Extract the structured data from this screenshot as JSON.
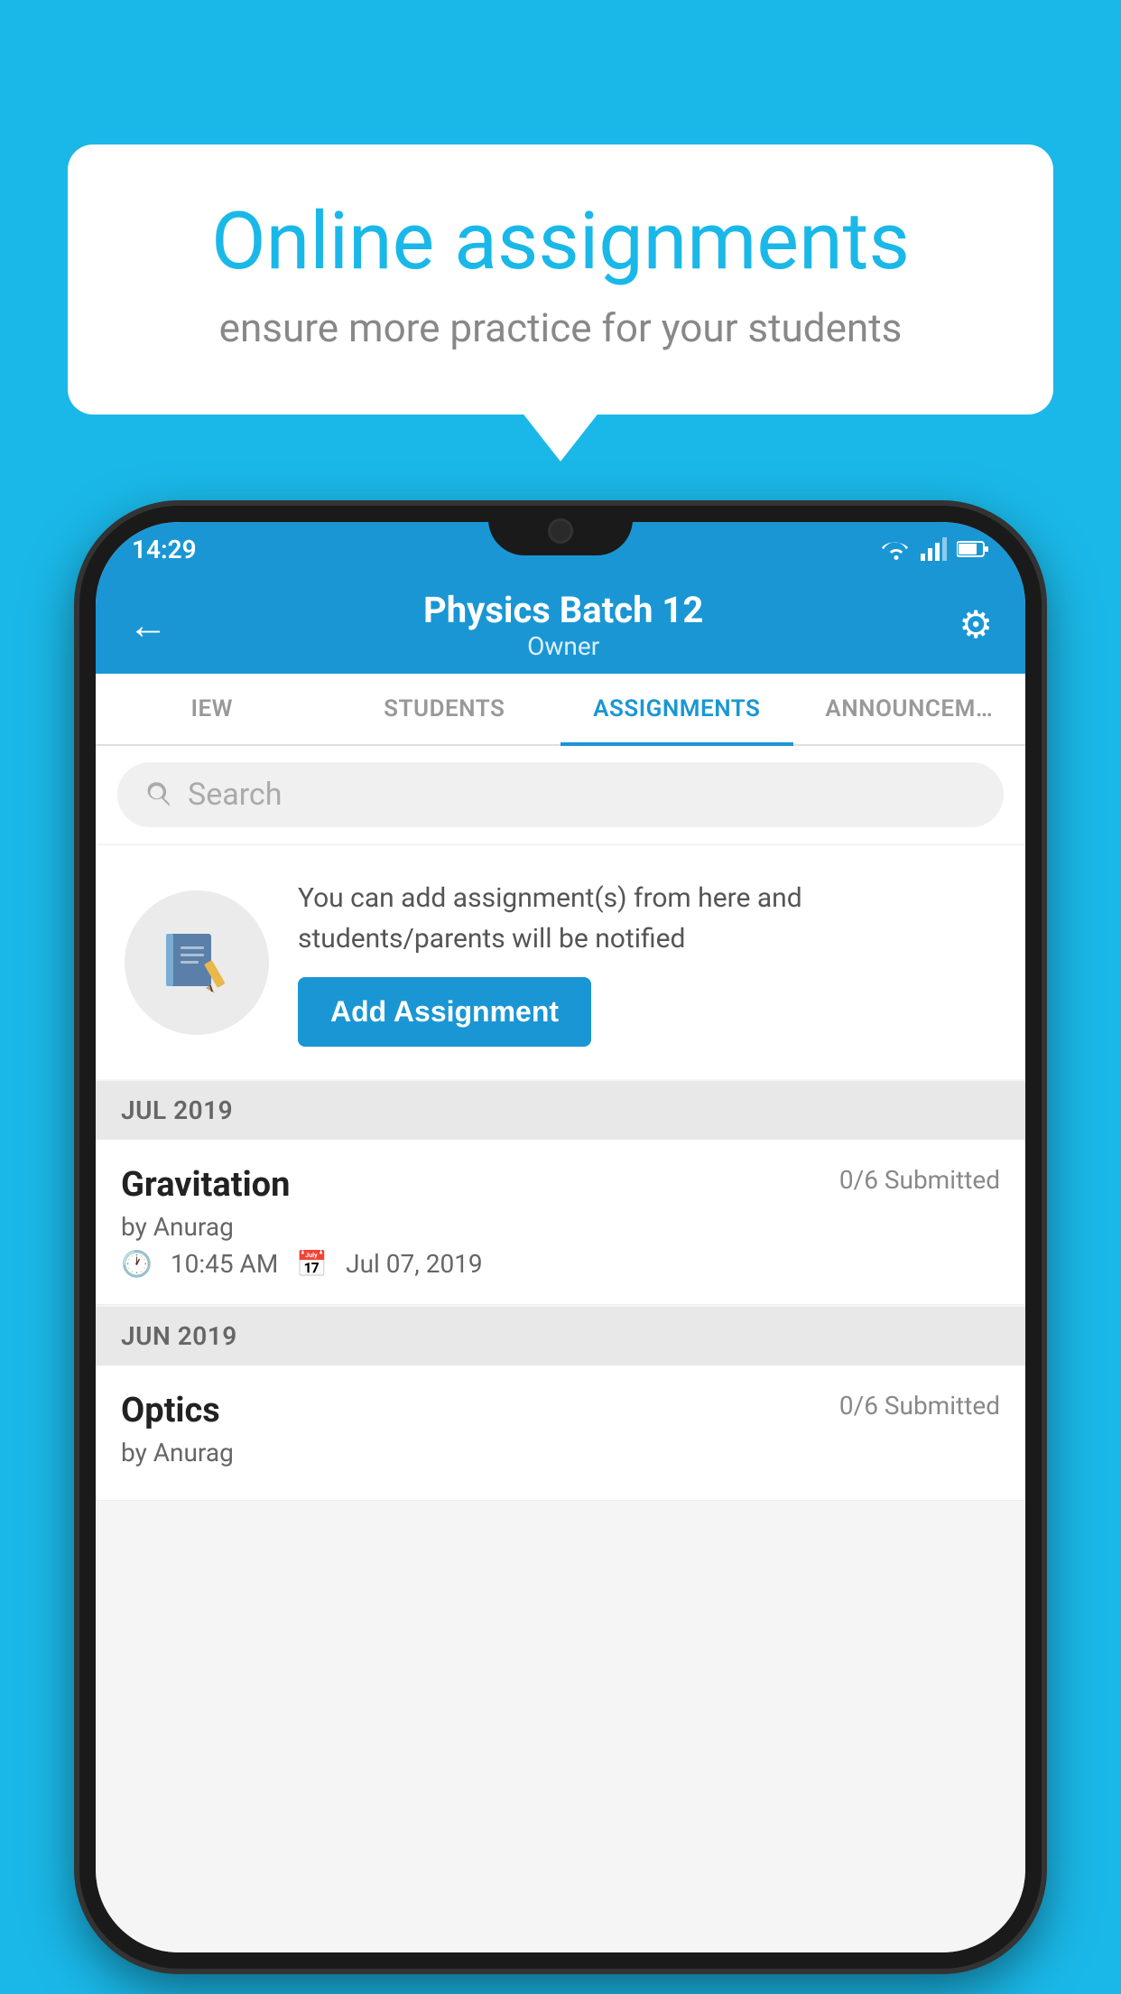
{
  "background_color": "#1ab8e8",
  "speech_bubble": {
    "title": "Online assignments",
    "subtitle": "ensure more practice for your students"
  },
  "phone": {
    "status_bar": {
      "time": "14:29",
      "icons": [
        "wifi",
        "signal",
        "battery"
      ]
    },
    "header": {
      "title": "Physics Batch 12",
      "subtitle": "Owner",
      "back_label": "←",
      "gear_label": "⚙"
    },
    "tabs": [
      {
        "label": "IEW",
        "active": false
      },
      {
        "label": "STUDENTS",
        "active": false
      },
      {
        "label": "ASSIGNMENTS",
        "active": true
      },
      {
        "label": "ANNOUNCEM…",
        "active": false
      }
    ],
    "search": {
      "placeholder": "Search"
    },
    "promo": {
      "description": "You can add assignment(s) from here and students/parents will be notified",
      "button_label": "Add Assignment"
    },
    "sections": [
      {
        "label": "JUL 2019",
        "assignments": [
          {
            "name": "Gravitation",
            "submitted": "0/6 Submitted",
            "author": "by Anurag",
            "time": "10:45 AM",
            "date": "Jul 07, 2019"
          }
        ]
      },
      {
        "label": "JUN 2019",
        "assignments": [
          {
            "name": "Optics",
            "submitted": "0/6 Submitted",
            "author": "by Anurag",
            "time": "",
            "date": ""
          }
        ]
      }
    ]
  }
}
